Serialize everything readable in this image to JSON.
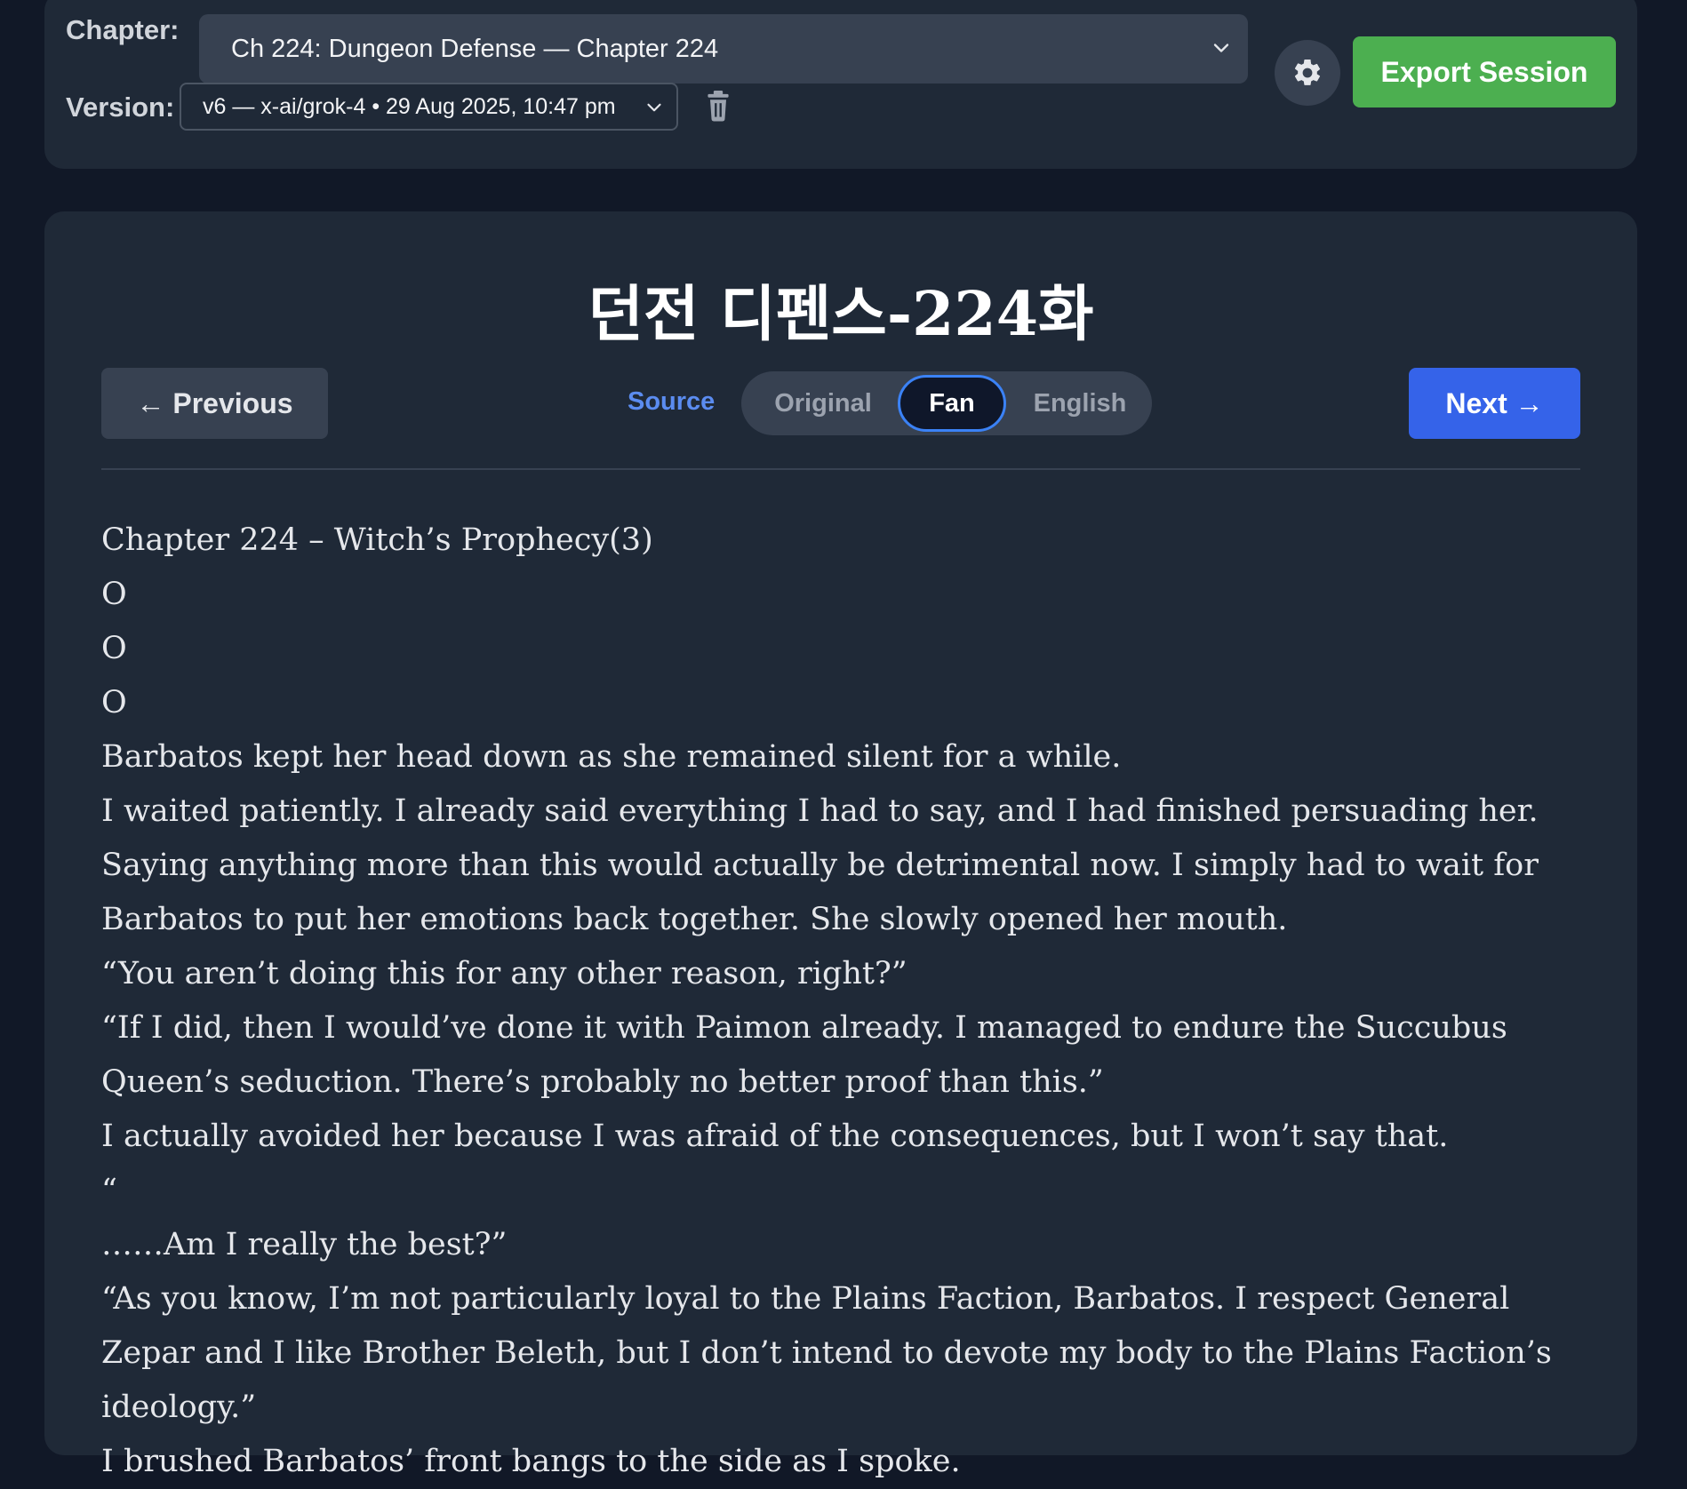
{
  "topbar": {
    "chapter_label": "Chapter:",
    "chapter_value": "Ch 224: Dungeon Defense — Chapter 224",
    "version_label": "Version:",
    "version_value": "v6 — x-ai/grok-4 • 29 Aug 2025, 10:47 pm",
    "export_label": "Export Session"
  },
  "main": {
    "title": "던전 디펜스-224화",
    "prev_label": "← Previous",
    "next_label": "Next →",
    "source_label": "Source",
    "toggle": {
      "original": "Original",
      "fan": "Fan",
      "english": "English",
      "selected": "Fan"
    },
    "paragraphs": [
      "Chapter 224 – Witch’s Prophecy(3)",
      "O",
      "O",
      "O",
      "Barbatos kept her head down as she remained silent for a while.",
      "I waited patiently. I already said everything I had to say, and I had finished persuading her. Saying anything more than this would actually be detrimental now. I simply had to wait for Barbatos to put her emotions back together. She slowly opened her mouth.",
      "“You aren’t doing this for any other reason, right?”",
      "“If I did, then I would’ve done it with Paimon already. I managed to endure the Succubus Queen’s seduction. There’s probably no better proof than this.”",
      "I actually avoided her because I was afraid of the consequences, but I won’t say that.",
      "“",
      "……Am I really the best?”",
      "“As you know, I’m not particularly loyal to the Plains Faction, Barbatos. I respect General Zepar and I like Brother Beleth, but I don’t intend to devote my body to the Plains Faction’s ideology.”",
      "I brushed Barbatos’ front bangs to the side as I spoke."
    ]
  },
  "colors": {
    "background": "#111827",
    "panel": "#1f2937",
    "export_green": "#4caf50",
    "next_blue": "#3563e9",
    "source_blue": "#5b8cf0"
  },
  "icons": {
    "chapter_dropdown": "chevron-down-icon",
    "version_dropdown": "chevron-down-icon",
    "delete": "trash-icon",
    "settings": "gear-icon"
  }
}
